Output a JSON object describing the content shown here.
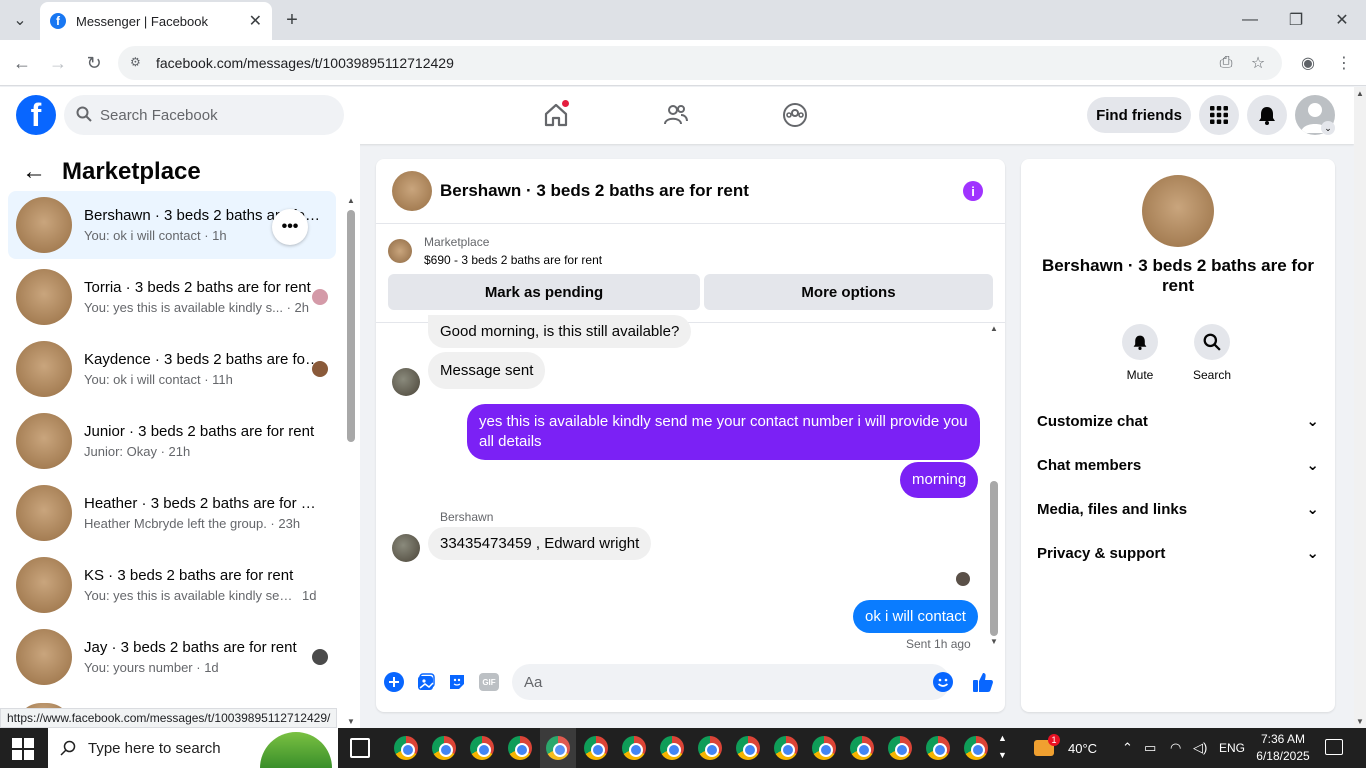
{
  "browser": {
    "tab_title": "Messenger | Facebook",
    "url": "facebook.com/messages/t/10039895112712429",
    "status_link": "https://www.facebook.com/messages/t/10039895112712429/"
  },
  "fb": {
    "search_placeholder": "Search Facebook",
    "find_friends": "Find friends"
  },
  "left": {
    "title": "Marketplace",
    "conversations": [
      {
        "name": "Bershawn · 3 beds 2 baths are for rent",
        "sub": "You: ok i will contact · 1h"
      },
      {
        "name": "Torria · 3 beds 2 baths are for rent",
        "sub": "You: yes this is available kindly s... · 2h"
      },
      {
        "name": "Kaydence · 3 beds 2 baths are for rent",
        "sub": "You: ok i will contact · 11h"
      },
      {
        "name": "Junior · 3 beds 2 baths are for rent",
        "sub": "Junior: Okay · 21h"
      },
      {
        "name": "Heather · 3 beds 2 baths are for rent",
        "sub": "Heather Mcbryde left the group. · 23h"
      },
      {
        "name": "KS · 3 beds 2 baths are for rent",
        "sub": "You: yes this is available kindly sen...",
        "time": "1d"
      },
      {
        "name": "Jay · 3 beds 2 baths are for rent",
        "sub": "You: yours number · 1d"
      }
    ]
  },
  "chat": {
    "title": "Bershawn · 3 beds 2 baths are for rent",
    "marketplace_label": "Marketplace",
    "listing": "$690 - 3 beds 2 baths are for rent",
    "mark_pending": "Mark as pending",
    "more_options": "More options",
    "messages": {
      "m1": "Good morning, is this still available?",
      "m2": "Message sent",
      "m3": "yes  this is available kindly send me your contact number i will provide you all details",
      "m4": "morning",
      "sender": "Bershawn",
      "m5": "33435473459 , Edward wright",
      "m6": "ok i will contact",
      "sent_status": "Sent 1h ago"
    },
    "composer_placeholder": "Aa",
    "gif_label": "GIF"
  },
  "right": {
    "name": "Bershawn · 3 beds 2 baths are for rent",
    "mute": "Mute",
    "search": "Search",
    "rows": [
      "Customize chat",
      "Chat members",
      "Media, files and links",
      "Privacy & support"
    ]
  },
  "taskbar": {
    "search_placeholder": "Type here to search",
    "temperature": "40°C",
    "weather_badge": "1",
    "language": "ENG",
    "time": "7:36 AM",
    "date": "6/18/2025"
  },
  "colors": {
    "fb_blue": "#0866ff",
    "outgoing_purple": "#7b21f5",
    "outgoing_blue": "#0a7cff",
    "info_purple": "#a033ff"
  }
}
